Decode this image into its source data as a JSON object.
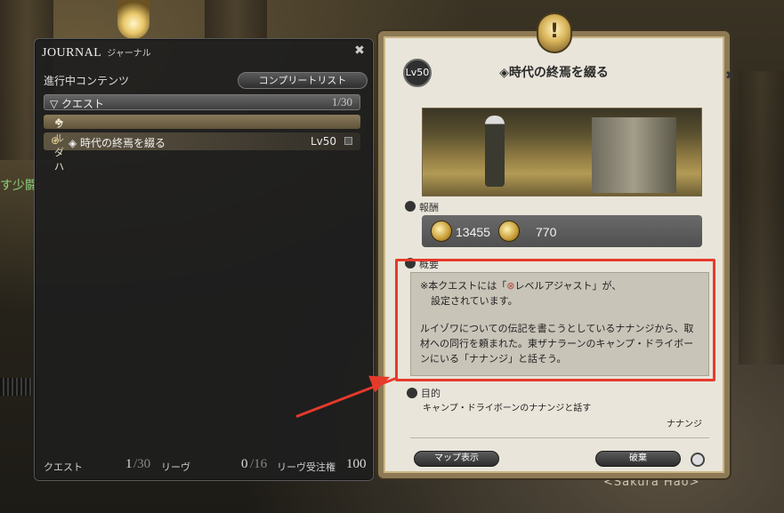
{
  "background": {
    "side_text": "す少闘:",
    "player_name": "<Sakura Hao>"
  },
  "journal": {
    "title": "JOURNAL",
    "subtitle": "ジャーナル",
    "section_label": "進行中コンテンツ",
    "complete_list_button": "コンプリートリスト",
    "quest_category": {
      "label": "クエスト",
      "count": "1/30"
    },
    "region": "ウルダハ",
    "quests": [
      {
        "name": "時代の終焉を綴る",
        "level": "Lv50"
      }
    ],
    "footer": {
      "quest_label": "クエスト",
      "quest_count": "1",
      "quest_max": "/30",
      "leve_label": "リーヴ",
      "leve_count": "0",
      "leve_max": "/16",
      "allowance_label": "リーヴ受注権",
      "allowance_value": "100"
    }
  },
  "detail": {
    "level_badge": "Lv50",
    "title": "時代の終焉を綴る",
    "reward_label": "報酬",
    "rewards": {
      "gil": "13455",
      "seals": "770"
    },
    "overview_label": "概要",
    "description": {
      "line1": "※本クエストには「",
      "line1_tag": "レベルアジャスト",
      "line1_end": "」が、",
      "line2": "設定されています。",
      "para1": "ルイゾワについての伝記を書こうとしているナナンジから、取",
      "para2": "材への同行を頼まれた。東ザナラーンのキャンプ・ドライボー",
      "para3": "ンにいる「ナナンジ」と話そう。"
    },
    "objective_label": "目的",
    "objective": "キャンプ・ドライボーンのナナンジと話す",
    "npc": "ナナンジ",
    "map_button": "マップ表示",
    "abandon_button": "破棄"
  },
  "colors": {
    "highlight": "#e63a2a",
    "parchment": "#e9e5da",
    "frame": "#8d7a55"
  }
}
